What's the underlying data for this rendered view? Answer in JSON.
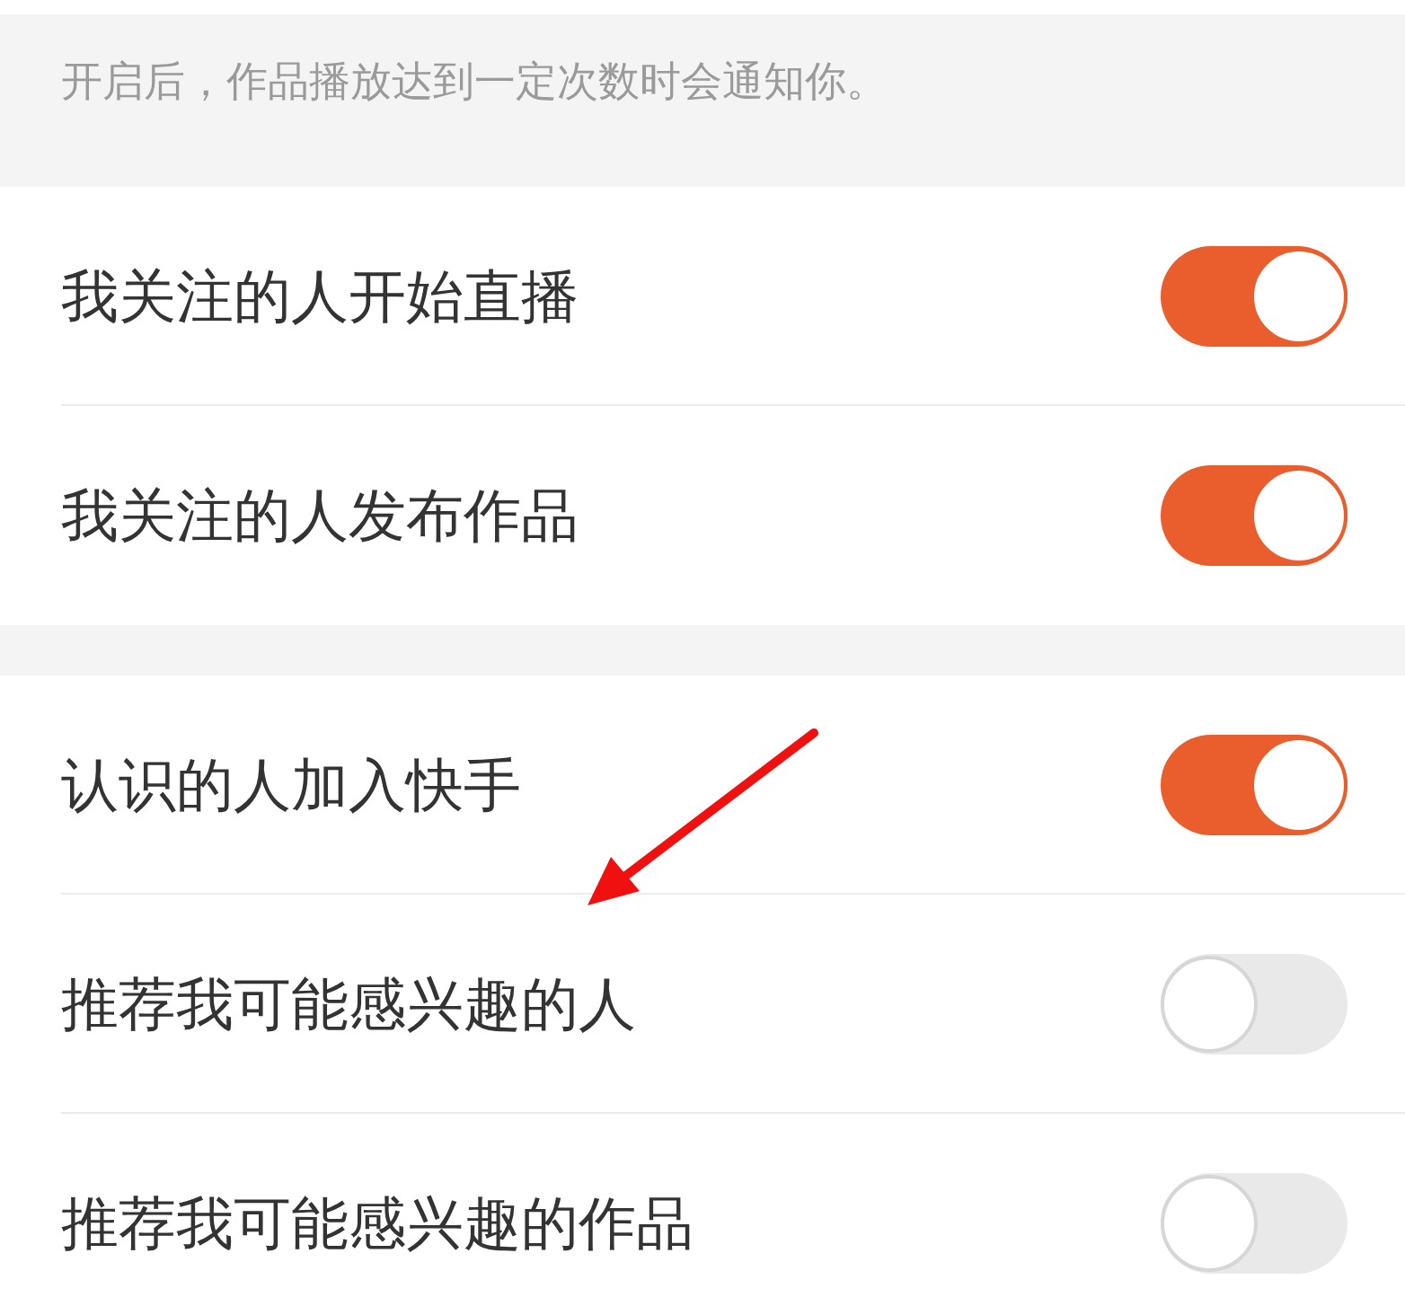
{
  "hint": "开启后，作品播放达到一定次数时会通知你。",
  "groups": [
    {
      "rows": [
        {
          "label": "我关注的人开始直播",
          "on": true
        },
        {
          "label": "我关注的人发布作品",
          "on": true
        }
      ]
    },
    {
      "rows": [
        {
          "label": "认识的人加入快手",
          "on": true
        },
        {
          "label": "推荐我可能感兴趣的人",
          "on": false
        },
        {
          "label": "推荐我可能感兴趣的作品",
          "on": false
        }
      ]
    }
  ]
}
